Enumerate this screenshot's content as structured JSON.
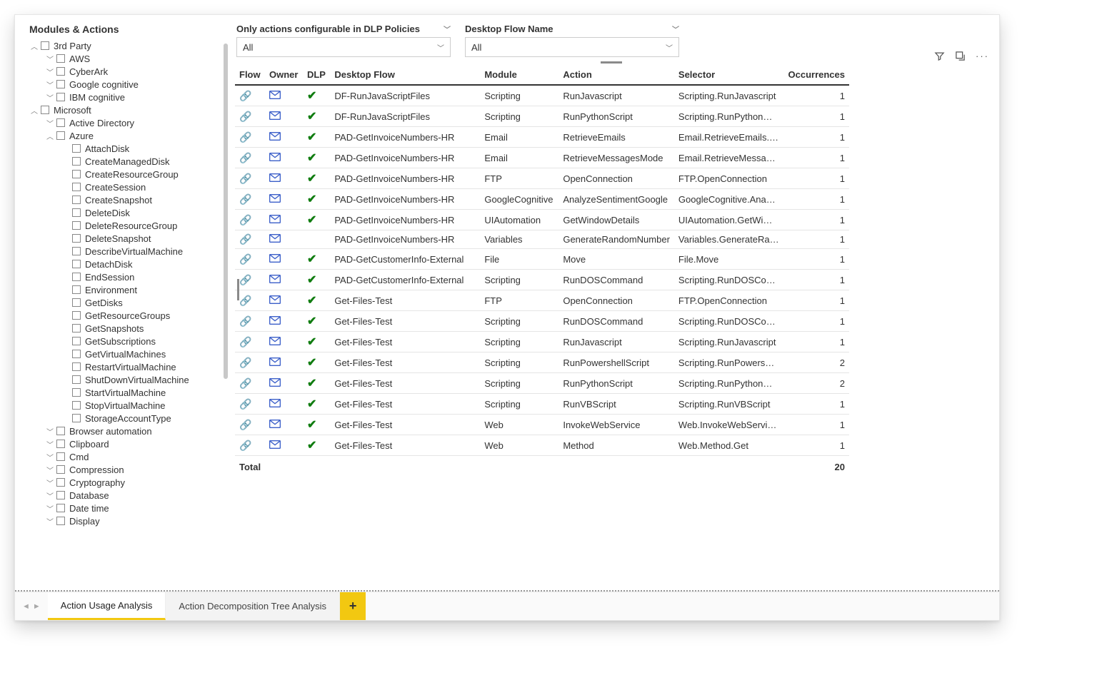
{
  "leftPanel": {
    "title": "Modules & Actions",
    "tree": [
      {
        "depth": 0,
        "caret": "up",
        "checkbox": true,
        "label": "3rd Party"
      },
      {
        "depth": 1,
        "caret": "down",
        "checkbox": true,
        "label": "AWS"
      },
      {
        "depth": 1,
        "caret": "down",
        "checkbox": true,
        "label": "CyberArk"
      },
      {
        "depth": 1,
        "caret": "down",
        "checkbox": true,
        "label": "Google cognitive"
      },
      {
        "depth": 1,
        "caret": "down",
        "checkbox": true,
        "label": "IBM cognitive"
      },
      {
        "depth": 0,
        "caret": "up",
        "checkbox": true,
        "label": "Microsoft"
      },
      {
        "depth": 1,
        "caret": "down",
        "checkbox": true,
        "label": "Active Directory"
      },
      {
        "depth": 1,
        "caret": "up",
        "checkbox": true,
        "label": "Azure"
      },
      {
        "depth": 2,
        "caret": "",
        "checkbox": true,
        "label": "AttachDisk"
      },
      {
        "depth": 2,
        "caret": "",
        "checkbox": true,
        "label": "CreateManagedDisk"
      },
      {
        "depth": 2,
        "caret": "",
        "checkbox": true,
        "label": "CreateResourceGroup"
      },
      {
        "depth": 2,
        "caret": "",
        "checkbox": true,
        "label": "CreateSession"
      },
      {
        "depth": 2,
        "caret": "",
        "checkbox": true,
        "label": "CreateSnapshot"
      },
      {
        "depth": 2,
        "caret": "",
        "checkbox": true,
        "label": "DeleteDisk"
      },
      {
        "depth": 2,
        "caret": "",
        "checkbox": true,
        "label": "DeleteResourceGroup"
      },
      {
        "depth": 2,
        "caret": "",
        "checkbox": true,
        "label": "DeleteSnapshot"
      },
      {
        "depth": 2,
        "caret": "",
        "checkbox": true,
        "label": "DescribeVirtualMachine"
      },
      {
        "depth": 2,
        "caret": "",
        "checkbox": true,
        "label": "DetachDisk"
      },
      {
        "depth": 2,
        "caret": "",
        "checkbox": true,
        "label": "EndSession"
      },
      {
        "depth": 2,
        "caret": "",
        "checkbox": true,
        "label": "Environment"
      },
      {
        "depth": 2,
        "caret": "",
        "checkbox": true,
        "label": "GetDisks"
      },
      {
        "depth": 2,
        "caret": "",
        "checkbox": true,
        "label": "GetResourceGroups"
      },
      {
        "depth": 2,
        "caret": "",
        "checkbox": true,
        "label": "GetSnapshots"
      },
      {
        "depth": 2,
        "caret": "",
        "checkbox": true,
        "label": "GetSubscriptions"
      },
      {
        "depth": 2,
        "caret": "",
        "checkbox": true,
        "label": "GetVirtualMachines"
      },
      {
        "depth": 2,
        "caret": "",
        "checkbox": true,
        "label": "RestartVirtualMachine"
      },
      {
        "depth": 2,
        "caret": "",
        "checkbox": true,
        "label": "ShutDownVirtualMachine"
      },
      {
        "depth": 2,
        "caret": "",
        "checkbox": true,
        "label": "StartVirtualMachine"
      },
      {
        "depth": 2,
        "caret": "",
        "checkbox": true,
        "label": "StopVirtualMachine"
      },
      {
        "depth": 2,
        "caret": "",
        "checkbox": true,
        "label": "StorageAccountType"
      },
      {
        "depth": 1,
        "caret": "down",
        "checkbox": true,
        "label": "Browser automation"
      },
      {
        "depth": 1,
        "caret": "down",
        "checkbox": true,
        "label": "Clipboard"
      },
      {
        "depth": 1,
        "caret": "down",
        "checkbox": true,
        "label": "Cmd"
      },
      {
        "depth": 1,
        "caret": "down",
        "checkbox": true,
        "label": "Compression"
      },
      {
        "depth": 1,
        "caret": "down",
        "checkbox": true,
        "label": "Cryptography"
      },
      {
        "depth": 1,
        "caret": "down",
        "checkbox": true,
        "label": "Database"
      },
      {
        "depth": 1,
        "caret": "down",
        "checkbox": true,
        "label": "Date time"
      },
      {
        "depth": 1,
        "caret": "down",
        "checkbox": true,
        "label": "Display"
      }
    ]
  },
  "filters": {
    "dlp": {
      "label": "Only actions configurable in DLP Policies",
      "value": "All"
    },
    "flow": {
      "label": "Desktop Flow Name",
      "value": "All"
    }
  },
  "table": {
    "headers": {
      "flow": "Flow",
      "owner": "Owner",
      "dlp": "DLP",
      "name": "Desktop Flow",
      "module": "Module",
      "action": "Action",
      "selector": "Selector",
      "occ": "Occurrences"
    },
    "rows": [
      {
        "dlp": true,
        "name": "DF-RunJavaScriptFiles",
        "module": "Scripting",
        "action": "RunJavascript",
        "selector": "Scripting.RunJavascript",
        "occ": "1"
      },
      {
        "dlp": true,
        "name": "DF-RunJavaScriptFiles",
        "module": "Scripting",
        "action": "RunPythonScript",
        "selector": "Scripting.RunPython…",
        "occ": "1"
      },
      {
        "dlp": true,
        "name": "PAD-GetInvoiceNumbers-HR",
        "module": "Email",
        "action": "RetrieveEmails",
        "selector": "Email.RetrieveEmails.…",
        "occ": "1"
      },
      {
        "dlp": true,
        "name": "PAD-GetInvoiceNumbers-HR",
        "module": "Email",
        "action": "RetrieveMessagesMode",
        "selector": "Email.RetrieveMessa…",
        "occ": "1"
      },
      {
        "dlp": true,
        "name": "PAD-GetInvoiceNumbers-HR",
        "module": "FTP",
        "action": "OpenConnection",
        "selector": "FTP.OpenConnection",
        "occ": "1"
      },
      {
        "dlp": true,
        "name": "PAD-GetInvoiceNumbers-HR",
        "module": "GoogleCognitive",
        "action": "AnalyzeSentimentGoogle",
        "selector": "GoogleCognitive.Ana…",
        "occ": "1"
      },
      {
        "dlp": true,
        "name": "PAD-GetInvoiceNumbers-HR",
        "module": "UIAutomation",
        "action": "GetWindowDetails",
        "selector": "UIAutomation.GetWi…",
        "occ": "1"
      },
      {
        "dlp": false,
        "name": "PAD-GetInvoiceNumbers-HR",
        "module": "Variables",
        "action": "GenerateRandomNumber",
        "selector": "Variables.GenerateRa…",
        "occ": "1"
      },
      {
        "dlp": true,
        "name": "PAD-GetCustomerInfo-External",
        "module": "File",
        "action": "Move",
        "selector": "File.Move",
        "occ": "1"
      },
      {
        "dlp": true,
        "name": "PAD-GetCustomerInfo-External",
        "module": "Scripting",
        "action": "RunDOSCommand",
        "selector": "Scripting.RunDOSCo…",
        "occ": "1"
      },
      {
        "dlp": true,
        "name": "Get-Files-Test",
        "module": "FTP",
        "action": "OpenConnection",
        "selector": "FTP.OpenConnection",
        "occ": "1"
      },
      {
        "dlp": true,
        "name": "Get-Files-Test",
        "module": "Scripting",
        "action": "RunDOSCommand",
        "selector": "Scripting.RunDOSCo…",
        "occ": "1"
      },
      {
        "dlp": true,
        "name": "Get-Files-Test",
        "module": "Scripting",
        "action": "RunJavascript",
        "selector": "Scripting.RunJavascript",
        "occ": "1"
      },
      {
        "dlp": true,
        "name": "Get-Files-Test",
        "module": "Scripting",
        "action": "RunPowershellScript",
        "selector": "Scripting.RunPowers…",
        "occ": "2"
      },
      {
        "dlp": true,
        "name": "Get-Files-Test",
        "module": "Scripting",
        "action": "RunPythonScript",
        "selector": "Scripting.RunPython…",
        "occ": "2"
      },
      {
        "dlp": true,
        "name": "Get-Files-Test",
        "module": "Scripting",
        "action": "RunVBScript",
        "selector": "Scripting.RunVBScript",
        "occ": "1"
      },
      {
        "dlp": true,
        "name": "Get-Files-Test",
        "module": "Web",
        "action": "InvokeWebService",
        "selector": "Web.InvokeWebServi…",
        "occ": "1"
      },
      {
        "dlp": true,
        "name": "Get-Files-Test",
        "module": "Web",
        "action": "Method",
        "selector": "Web.Method.Get",
        "occ": "1"
      }
    ],
    "totalLabel": "Total",
    "totalValue": "20"
  },
  "tabs": {
    "prev": "◄",
    "next": "►",
    "items": [
      {
        "label": "Action Usage Analysis",
        "active": true
      },
      {
        "label": "Action Decomposition Tree Analysis",
        "active": false
      }
    ],
    "add": "+"
  }
}
